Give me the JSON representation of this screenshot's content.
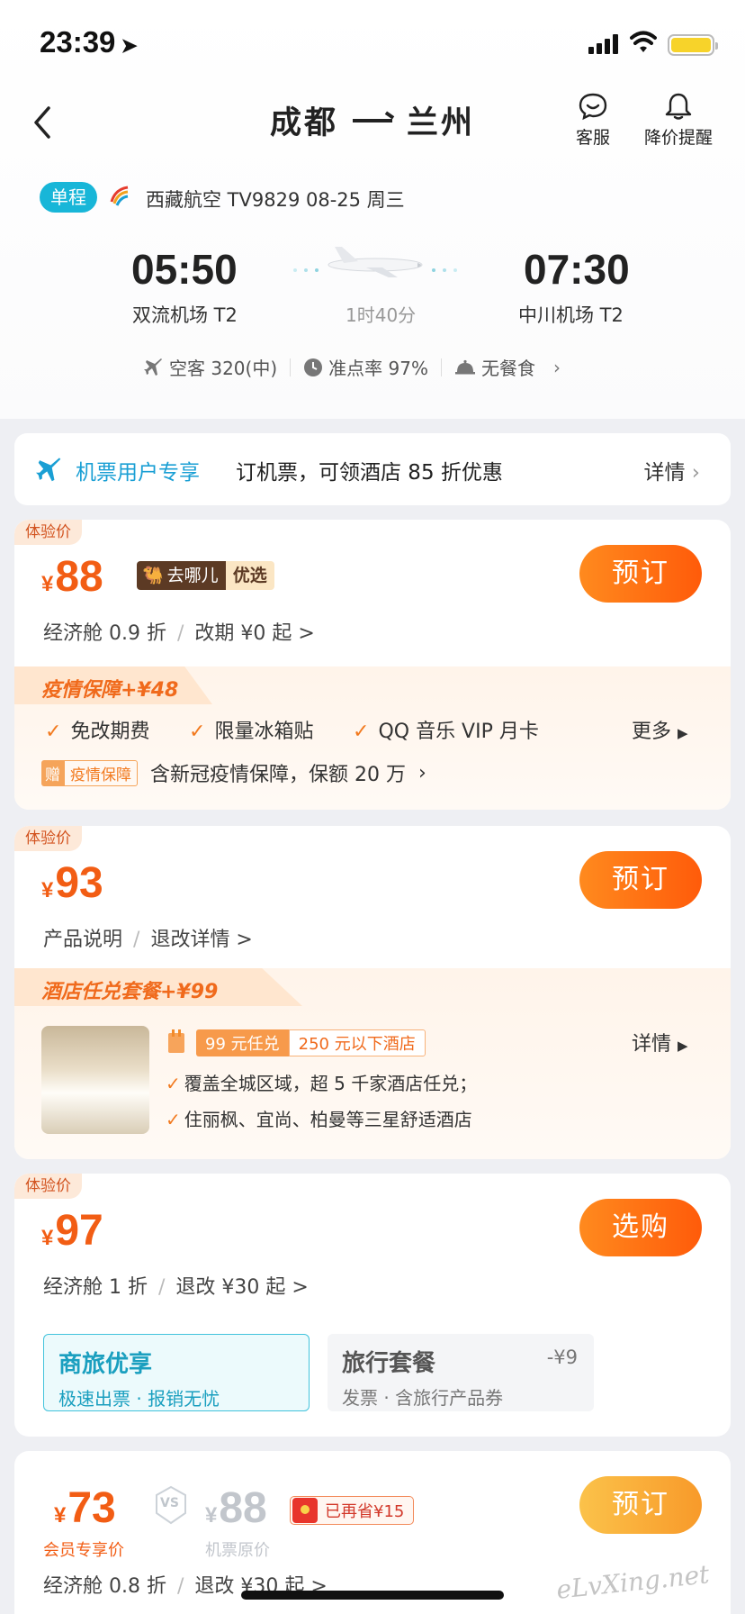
{
  "status_bar": {
    "time": "23:39"
  },
  "nav": {
    "origin": "成都",
    "destination": "兰州",
    "service_label": "客服",
    "alert_label": "降价提醒"
  },
  "flight": {
    "trip_type": "单程",
    "meta": "西藏航空 TV9829  08-25 周三",
    "depart_time": "05:50",
    "depart_airport": "双流机场 T2",
    "arrive_time": "07:30",
    "arrive_airport": "中川机场 T2",
    "duration": "1时40分",
    "aircraft": "空客 320(中)",
    "on_time": "准点率 97%",
    "meal": "无餐食"
  },
  "promo": {
    "label": "机票用户专享",
    "text": "订机票，可领酒店 85 折优惠",
    "more": "详情"
  },
  "offers": [
    {
      "tag": "体验价",
      "yen": "¥",
      "price": "88",
      "badge_a": "去哪儿",
      "badge_b": "优选",
      "button": "预订",
      "sub_a": "经济舱 0.9 折",
      "sub_b": "改期 ¥0 起 >",
      "package_title": "疫情保障+¥48",
      "checks": [
        "免改期费",
        "限量冰箱贴",
        "QQ 音乐 VIP 月卡"
      ],
      "more": "更多",
      "gift_a": "赠",
      "gift_b": "疫情保障",
      "gift_text": "含新冠疫情保障，保额 20 万"
    },
    {
      "tag": "体验价",
      "yen": "¥",
      "price": "93",
      "button": "预订",
      "sub_a": "产品说明",
      "sub_b": "退改详情 >",
      "package_title": "酒店任兑套餐+¥99",
      "hotel_tag_a": "99 元任兑",
      "hotel_tag_b": "250 元以下酒店",
      "more": "详情",
      "lines": [
        "覆盖全城区域，超 5 千家酒店任兑；",
        "住丽枫、宜尚、柏曼等三星舒适酒店"
      ]
    },
    {
      "tag": "体验价",
      "yen": "¥",
      "price": "97",
      "button": "选购",
      "sub_a": "经济舱 1 折",
      "sub_b": "退改 ¥30 起 >",
      "opt1_title": "商旅优享",
      "opt1_sub": "极速出票 · 报销无忧",
      "opt2_title": "旅行套餐",
      "opt2_sub": "发票 · 含旅行产品券",
      "opt2_diff": "-¥9"
    },
    {
      "yen": "¥",
      "price": "73",
      "member_label": "会员专享价",
      "vs": "VS",
      "orig_price": "88",
      "orig_label": "机票原价",
      "saved": "已再省¥15",
      "button": "预订",
      "sub_a": "经济舱 0.8 折",
      "sub_b": "退改 ¥30 起 >"
    }
  ],
  "watermark": "eLvXing.net",
  "colors": {
    "accent": "#f25d14",
    "teal": "#18b6d8",
    "promo_blue": "#1a9fd4"
  }
}
